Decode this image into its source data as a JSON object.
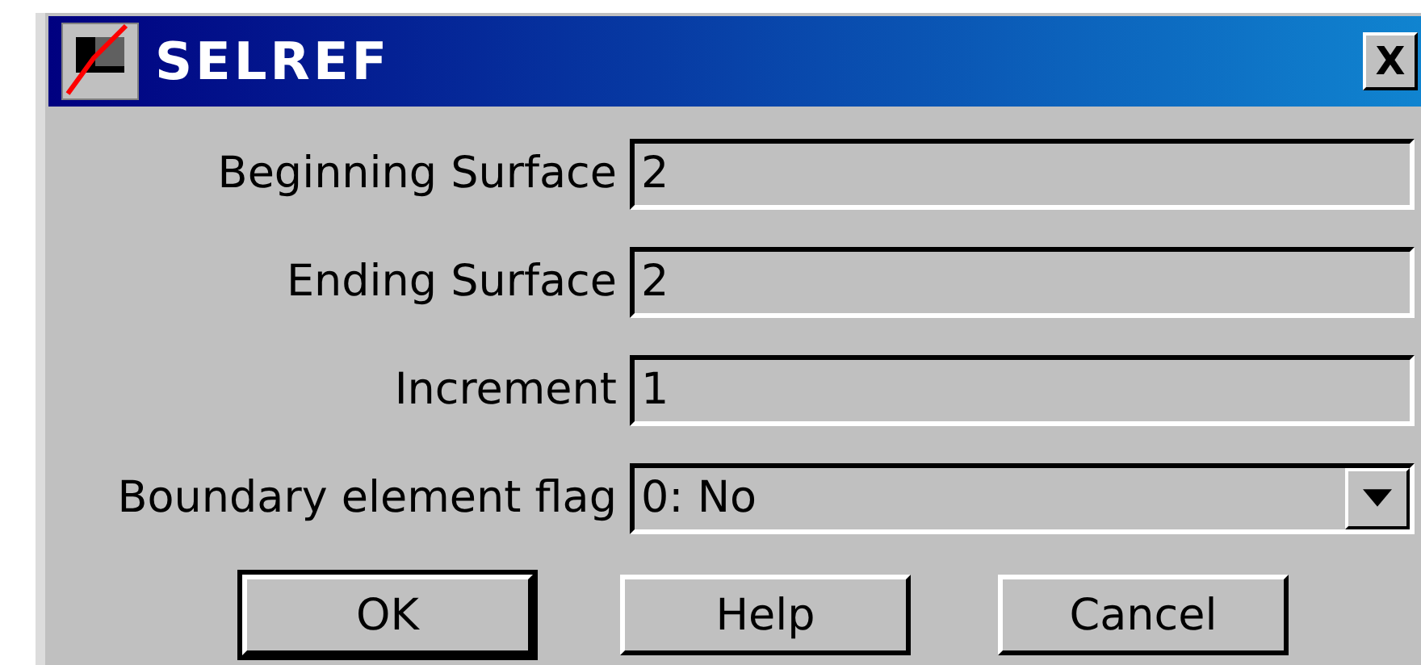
{
  "window": {
    "title": "SELREF",
    "close": "X"
  },
  "fields": [
    {
      "label": "Beginning Surface",
      "value": "2",
      "kind": "text"
    },
    {
      "label": "Ending Surface",
      "value": "2",
      "kind": "text"
    },
    {
      "label": "Increment",
      "value": "1",
      "kind": "text"
    },
    {
      "label": "Boundary element flag",
      "value": "0: No",
      "kind": "dropdown"
    }
  ],
  "buttons": [
    {
      "label": "OK",
      "default": true
    },
    {
      "label": "Help",
      "default": false
    },
    {
      "label": "Cancel",
      "default": false
    }
  ]
}
